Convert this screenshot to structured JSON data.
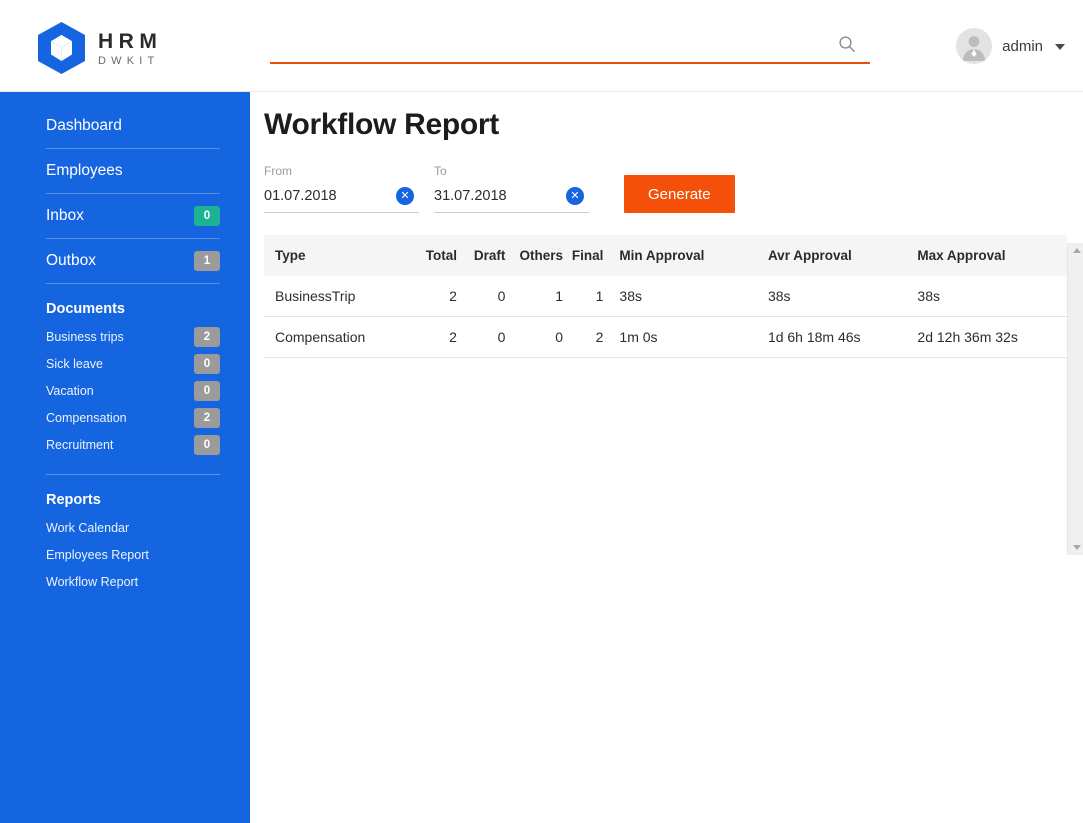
{
  "header": {
    "logo_primary": "HRM",
    "logo_secondary": "DWKIT",
    "logo_icon": "hexagon-cube-icon",
    "search": {
      "value": "",
      "placeholder": "",
      "icon": "search-icon"
    },
    "user": {
      "name": "admin",
      "avatar_icon": "user-avatar-icon",
      "caret_icon": "chevron-down-icon"
    }
  },
  "sidebar": {
    "accent_color": "#1565e0",
    "main_items": [
      {
        "label": "Dashboard",
        "badge": null,
        "badge_color": null
      },
      {
        "label": "Employees",
        "badge": null,
        "badge_color": null
      },
      {
        "label": "Inbox",
        "badge": "0",
        "badge_color": "#1bb394"
      },
      {
        "label": "Outbox",
        "badge": "1",
        "badge_color": "#9b9b9b"
      }
    ],
    "documents": {
      "title": "Documents",
      "items": [
        {
          "label": "Business trips",
          "badge": "2"
        },
        {
          "label": "Sick leave",
          "badge": "0"
        },
        {
          "label": "Vacation",
          "badge": "0"
        },
        {
          "label": "Compensation",
          "badge": "2"
        },
        {
          "label": "Recruitment",
          "badge": "0"
        }
      ]
    },
    "reports": {
      "title": "Reports",
      "items": [
        {
          "label": "Work Calendar"
        },
        {
          "label": "Employees Report"
        },
        {
          "label": "Workflow Report"
        }
      ]
    }
  },
  "main": {
    "page_title": "Workflow Report",
    "filters": {
      "from_label": "From",
      "from_value": "01.07.2018",
      "to_label": "To",
      "to_value": "31.07.2018",
      "clear_icon": "close-x-icon",
      "generate_label": "Generate",
      "generate_color": "#f4500a"
    },
    "table": {
      "columns": [
        "Type",
        "Total",
        "Draft",
        "Others",
        "Final",
        "Min Approval",
        "Avr Approval",
        "Max Approval"
      ],
      "rows": [
        {
          "type": "BusinessTrip",
          "total": "2",
          "draft": "0",
          "others": "1",
          "final": "1",
          "min_approval": "38s",
          "avr_approval": "38s",
          "max_approval": "38s"
        },
        {
          "type": "Compensation",
          "total": "2",
          "draft": "0",
          "others": "0",
          "final": "2",
          "min_approval": "1m 0s",
          "avr_approval": "1d 6h 18m 46s",
          "max_approval": "2d 12h 36m 32s"
        }
      ]
    }
  }
}
